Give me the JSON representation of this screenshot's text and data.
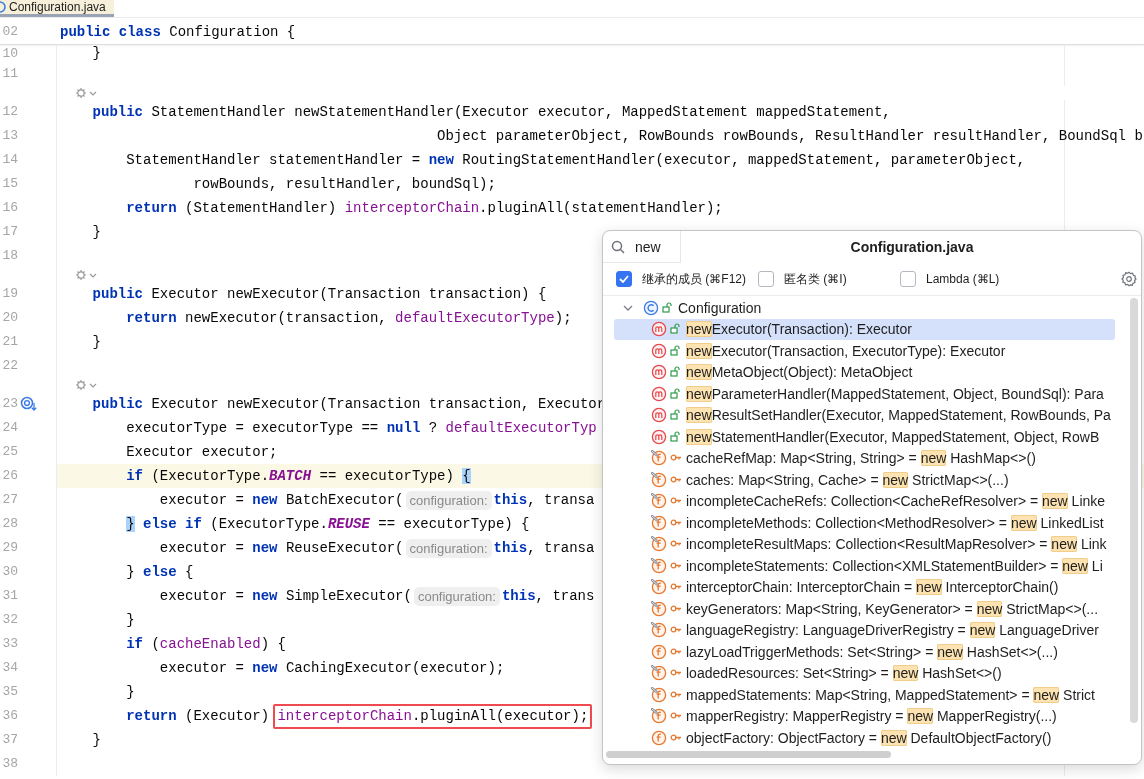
{
  "tab": {
    "title": "Configuration.java",
    "selected": true
  },
  "sticky_header": {
    "number": "02",
    "tokens": [
      {
        "kind": "kw",
        "text": "public class"
      },
      {
        "kind": "plain",
        "text": " Configuration {"
      }
    ]
  },
  "lines": [
    {
      "kind": "code",
      "number": "10",
      "parts": [
        {
          "kind": "code",
          "tokens": [
            {
              "kind": "plain",
              "text": "    }"
            }
          ]
        }
      ]
    },
    {
      "kind": "code",
      "number": "11"
    },
    {
      "kind": "marker"
    },
    {
      "kind": "code",
      "number": "12",
      "parts": [
        {
          "kind": "code",
          "tokens": [
            {
              "kind": "kw",
              "text": "    public"
            },
            {
              "kind": "plain",
              "text": " StatementHandler newStatementHandler(Executor executor, MappedStatement mappedStatement,"
            }
          ]
        }
      ]
    },
    {
      "kind": "code",
      "number": "13",
      "parts": [
        {
          "kind": "code",
          "tokens": [
            {
              "kind": "plain",
              "text": "                                             Object parameterObject, RowBounds rowBounds, ResultHandler resultHandler, BoundSql b"
            }
          ]
        }
      ]
    },
    {
      "kind": "code",
      "number": "14",
      "parts": [
        {
          "kind": "code",
          "tokens": [
            {
              "kind": "plain",
              "text": "        StatementHandler statementHandler = "
            },
            {
              "kind": "kw",
              "text": "new"
            },
            {
              "kind": "plain",
              "text": " RoutingStatementHandler(executor, mappedStatement, parameterObject,"
            }
          ]
        }
      ]
    },
    {
      "kind": "code",
      "number": "15",
      "parts": [
        {
          "kind": "code",
          "tokens": [
            {
              "kind": "plain",
              "text": "                rowBounds, resultHandler, boundSql);"
            }
          ]
        }
      ]
    },
    {
      "kind": "code",
      "number": "16",
      "parts": [
        {
          "kind": "code",
          "tokens": [
            {
              "kind": "kw",
              "text": "        return"
            },
            {
              "kind": "plain",
              "text": " (StatementHandler) "
            },
            {
              "kind": "field",
              "text": "interceptorChain"
            },
            {
              "kind": "plain",
              "text": ".pluginAll(statementHandler);"
            }
          ]
        }
      ]
    },
    {
      "kind": "code",
      "number": "17",
      "parts": [
        {
          "kind": "code",
          "tokens": [
            {
              "kind": "plain",
              "text": "    }"
            }
          ]
        }
      ]
    },
    {
      "kind": "code",
      "number": "18"
    },
    {
      "kind": "marker"
    },
    {
      "kind": "code",
      "number": "19",
      "parts": [
        {
          "kind": "code",
          "tokens": [
            {
              "kind": "kw",
              "text": "    public"
            },
            {
              "kind": "plain",
              "text": " Executor newExecutor(Transaction transaction) {"
            }
          ]
        }
      ]
    },
    {
      "kind": "code",
      "number": "20",
      "parts": [
        {
          "kind": "code",
          "tokens": [
            {
              "kind": "kw",
              "text": "        return"
            },
            {
              "kind": "plain",
              "text": " newExecutor(transaction, "
            },
            {
              "kind": "field",
              "text": "defaultExecutorType"
            },
            {
              "kind": "plain",
              "text": ");"
            }
          ]
        }
      ]
    },
    {
      "kind": "code",
      "number": "21",
      "parts": [
        {
          "kind": "code",
          "tokens": [
            {
              "kind": "plain",
              "text": "    }"
            }
          ]
        }
      ]
    },
    {
      "kind": "code",
      "number": "22"
    },
    {
      "kind": "marker"
    },
    {
      "kind": "code",
      "number": "23",
      "gutter_icon": true,
      "parts": [
        {
          "kind": "code",
          "tokens": [
            {
              "kind": "kw",
              "text": "    public"
            },
            {
              "kind": "plain",
              "text": " Executor newExecutor(Transaction transaction, Executor"
            }
          ]
        }
      ]
    },
    {
      "kind": "code",
      "number": "24",
      "parts": [
        {
          "kind": "code",
          "tokens": [
            {
              "kind": "plain",
              "text": "        executorType = executorType == "
            },
            {
              "kind": "kw",
              "text": "null"
            },
            {
              "kind": "plain",
              "text": " ? "
            },
            {
              "kind": "field",
              "text": "defaultExecutorTyp"
            }
          ]
        }
      ]
    },
    {
      "kind": "code",
      "number": "25",
      "parts": [
        {
          "kind": "code",
          "tokens": [
            {
              "kind": "plain",
              "text": "        Executor executor;"
            }
          ]
        }
      ]
    },
    {
      "kind": "code",
      "number": "26",
      "current": true,
      "parts": [
        {
          "kind": "code",
          "tokens": [
            {
              "kind": "kw",
              "text": "        if"
            },
            {
              "kind": "plain",
              "text": " (ExecutorType."
            },
            {
              "kind": "const",
              "text": "BATCH"
            },
            {
              "kind": "plain",
              "text": " == executorType) "
            },
            {
              "kind": "match",
              "text": "{"
            }
          ]
        }
      ]
    },
    {
      "kind": "code",
      "number": "27",
      "parts": [
        {
          "kind": "code",
          "tokens": [
            {
              "kind": "plain",
              "text": "            executor = "
            },
            {
              "kind": "kw",
              "text": "new"
            },
            {
              "kind": "plain",
              "text": " BatchExecutor("
            }
          ]
        },
        {
          "kind": "hint",
          "text": "configuration:"
        },
        {
          "kind": "code",
          "tokens": [
            {
              "kind": "kw",
              "text": "this"
            },
            {
              "kind": "plain",
              "text": ", transa"
            }
          ]
        }
      ]
    },
    {
      "kind": "code",
      "number": "28",
      "parts": [
        {
          "kind": "code",
          "tokens": [
            {
              "kind": "match",
              "text": "        }"
            },
            {
              "kind": "kw",
              "text": " else if"
            },
            {
              "kind": "plain",
              "text": " (ExecutorType."
            },
            {
              "kind": "const",
              "text": "REUSE"
            },
            {
              "kind": "plain",
              "text": " == executorType) {"
            }
          ]
        }
      ]
    },
    {
      "kind": "code",
      "number": "29",
      "parts": [
        {
          "kind": "code",
          "tokens": [
            {
              "kind": "plain",
              "text": "            executor = "
            },
            {
              "kind": "kw",
              "text": "new"
            },
            {
              "kind": "plain",
              "text": " ReuseExecutor("
            }
          ]
        },
        {
          "kind": "hint",
          "text": "configuration:"
        },
        {
          "kind": "code",
          "tokens": [
            {
              "kind": "kw",
              "text": "this"
            },
            {
              "kind": "plain",
              "text": ", transa"
            }
          ]
        }
      ]
    },
    {
      "kind": "code",
      "number": "30",
      "parts": [
        {
          "kind": "code",
          "tokens": [
            {
              "kind": "plain",
              "text": "        } "
            },
            {
              "kind": "kw",
              "text": "else"
            },
            {
              "kind": "plain",
              "text": " {"
            }
          ]
        }
      ]
    },
    {
      "kind": "code",
      "number": "31",
      "parts": [
        {
          "kind": "code",
          "tokens": [
            {
              "kind": "plain",
              "text": "            executor = "
            },
            {
              "kind": "kw",
              "text": "new"
            },
            {
              "kind": "plain",
              "text": " SimpleExecutor("
            }
          ]
        },
        {
          "kind": "hint",
          "text": "configuration:"
        },
        {
          "kind": "code",
          "tokens": [
            {
              "kind": "kw",
              "text": "this"
            },
            {
              "kind": "plain",
              "text": ", trans"
            }
          ]
        }
      ]
    },
    {
      "kind": "code",
      "number": "32",
      "parts": [
        {
          "kind": "code",
          "tokens": [
            {
              "kind": "plain",
              "text": "        }"
            }
          ]
        }
      ]
    },
    {
      "kind": "code",
      "number": "33",
      "parts": [
        {
          "kind": "code",
          "tokens": [
            {
              "kind": "kw",
              "text": "        if"
            },
            {
              "kind": "plain",
              "text": " ("
            },
            {
              "kind": "field",
              "text": "cacheEnabled"
            },
            {
              "kind": "plain",
              "text": ") {"
            }
          ]
        }
      ]
    },
    {
      "kind": "code",
      "number": "34",
      "parts": [
        {
          "kind": "code",
          "tokens": [
            {
              "kind": "plain",
              "text": "            executor = "
            },
            {
              "kind": "kw",
              "text": "new"
            },
            {
              "kind": "plain",
              "text": " CachingExecutor(executor);"
            }
          ]
        }
      ]
    },
    {
      "kind": "code",
      "number": "35",
      "parts": [
        {
          "kind": "code",
          "tokens": [
            {
              "kind": "plain",
              "text": "        }"
            }
          ]
        }
      ]
    },
    {
      "kind": "code",
      "number": "36",
      "parts": [
        {
          "kind": "code",
          "tokens": [
            {
              "kind": "kw",
              "text": "        return"
            },
            {
              "kind": "plain",
              "text": " (Executor) "
            }
          ]
        },
        {
          "kind": "boxed",
          "tokens": [
            {
              "kind": "field",
              "text": "interceptorChain"
            },
            {
              "kind": "plain",
              "text": ".pluginAll(executor);"
            }
          ]
        }
      ]
    },
    {
      "kind": "code",
      "number": "37",
      "parts": [
        {
          "kind": "code",
          "tokens": [
            {
              "kind": "plain",
              "text": "    }"
            }
          ]
        }
      ]
    },
    {
      "kind": "code",
      "number": "38"
    }
  ],
  "popup": {
    "search": {
      "value": "new"
    },
    "title": "Configuration.java",
    "options": [
      {
        "label": "继承的成员 (⌘F12)",
        "checked": true
      },
      {
        "label": "匿名类 (⌘I)",
        "checked": false
      },
      {
        "label": "Lambda (⌘L)",
        "checked": false
      }
    ],
    "tree": {
      "kind": "class",
      "public": true,
      "label": "Configuration",
      "expanded": true,
      "children": [
        {
          "kind": "method",
          "public": true,
          "selected": true,
          "match": "new",
          "suffix": "Executor(Transaction): Executor"
        },
        {
          "kind": "method",
          "public": true,
          "selected": false,
          "match": "new",
          "suffix": "Executor(Transaction, ExecutorType): Executor"
        },
        {
          "kind": "method",
          "public": true,
          "selected": false,
          "match": "new",
          "suffix": "MetaObject(Object): MetaObject"
        },
        {
          "kind": "method",
          "public": true,
          "selected": false,
          "match": "new",
          "suffix": "ParameterHandler(MappedStatement, Object, BoundSql): Para"
        },
        {
          "kind": "method",
          "public": true,
          "selected": false,
          "match": "new",
          "suffix": "ResultSetHandler(Executor, MappedStatement, RowBounds, Pa"
        },
        {
          "kind": "method",
          "public": true,
          "selected": false,
          "match": "new",
          "suffix": "StatementHandler(Executor, MappedStatement, Object, RowB"
        },
        {
          "kind": "field",
          "public": false,
          "overlay": true,
          "selected": false,
          "prefix": "cacheRefMap: Map<String, String> = ",
          "match": "new",
          "suffix": " HashMap<>()"
        },
        {
          "kind": "field",
          "public": false,
          "overlay": true,
          "selected": false,
          "prefix": "caches: Map<String, Cache> = ",
          "match": "new",
          "suffix": " StrictMap<>(...)"
        },
        {
          "kind": "field",
          "public": false,
          "overlay": true,
          "selected": false,
          "prefix": "incompleteCacheRefs: Collection<CacheRefResolver> = ",
          "match": "new",
          "suffix": " Linke"
        },
        {
          "kind": "field",
          "public": false,
          "overlay": true,
          "selected": false,
          "prefix": "incompleteMethods: Collection<MethodResolver> = ",
          "match": "new",
          "suffix": " LinkedList"
        },
        {
          "kind": "field",
          "public": false,
          "overlay": true,
          "selected": false,
          "prefix": "incompleteResultMaps: Collection<ResultMapResolver> = ",
          "match": "new",
          "suffix": " Link"
        },
        {
          "kind": "field",
          "public": false,
          "overlay": true,
          "selected": false,
          "prefix": "incompleteStatements: Collection<XMLStatementBuilder> = ",
          "match": "new",
          "suffix": " Li"
        },
        {
          "kind": "field",
          "public": false,
          "overlay": true,
          "selected": false,
          "prefix": "interceptorChain: InterceptorChain = ",
          "match": "new",
          "suffix": " InterceptorChain()"
        },
        {
          "kind": "field",
          "public": false,
          "overlay": true,
          "selected": false,
          "prefix": "keyGenerators: Map<String, KeyGenerator> = ",
          "match": "new",
          "suffix": " StrictMap<>(..."
        },
        {
          "kind": "field",
          "public": false,
          "overlay": true,
          "selected": false,
          "prefix": "languageRegistry: LanguageDriverRegistry = ",
          "match": "new",
          "suffix": " LanguageDriver"
        },
        {
          "kind": "field",
          "public": false,
          "overlay": false,
          "selected": false,
          "prefix": "lazyLoadTriggerMethods: Set<String> = ",
          "match": "new",
          "suffix": " HashSet<>(...)"
        },
        {
          "kind": "field",
          "public": false,
          "overlay": true,
          "selected": false,
          "prefix": "loadedResources: Set<String> = ",
          "match": "new",
          "suffix": " HashSet<>()"
        },
        {
          "kind": "field",
          "public": false,
          "overlay": true,
          "selected": false,
          "prefix": "mappedStatements: Map<String, MappedStatement> = ",
          "match": "new",
          "suffix": " Strict"
        },
        {
          "kind": "field",
          "public": false,
          "overlay": true,
          "selected": false,
          "prefix": "mapperRegistry: MapperRegistry = ",
          "match": "new",
          "suffix": " MapperRegistry(...)"
        },
        {
          "kind": "field",
          "public": false,
          "overlay": false,
          "selected": false,
          "prefix": "objectFactory: ObjectFactory = ",
          "match": "new",
          "suffix": " DefaultObjectFactory()"
        }
      ]
    }
  }
}
